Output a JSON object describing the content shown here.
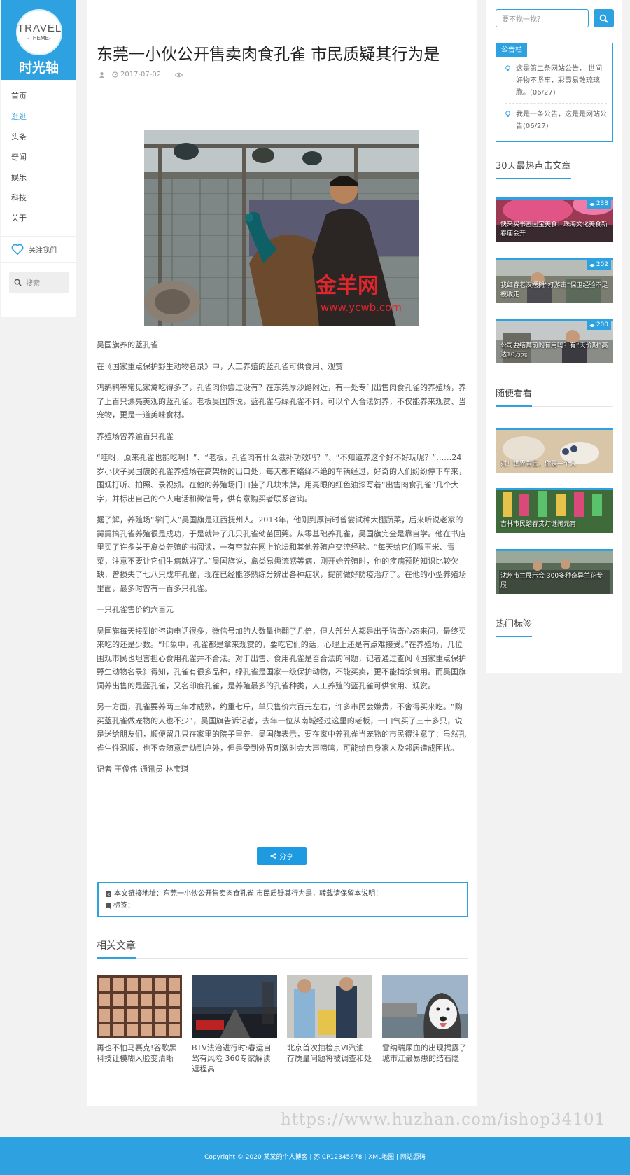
{
  "logo": {
    "word": "TRAVEL",
    "sub": "-THEME-",
    "title": "时光轴"
  },
  "nav": {
    "items": [
      "首页",
      "逛逛",
      "头条",
      "奇闻",
      "娱乐",
      "科技",
      "关于"
    ]
  },
  "follow": {
    "label": "关注我们"
  },
  "side_search": {
    "placeholder": "搜索"
  },
  "article": {
    "title": "东莞一小伙公开售卖肉食孔雀 市民质疑其行为是",
    "date": "2017-07-02",
    "paragraphs": [
      "吴国旗养的蓝孔雀",
      "在《国家重点保护野生动物名录》中，人工养殖的蓝孔雀可供食用、观赏",
      "鸡鹅鸭等常见家禽吃得多了，孔雀肉你尝过没有？在东莞厚沙路附近，有一处专门出售肉食孔雀的养殖场，养了上百只漂亮美观的蓝孔雀。老板吴国旗说，蓝孔雀与绿孔雀不同，可以个人合法饲养，不仅能养来观赏、当宠物，更是一道美味食材。",
      "养殖场曾养逾百只孔雀",
      "“哇呀，原来孔雀也能吃啊！”、“老板，孔雀肉有什么滋补功效吗？”、“不知道养这个好不好玩呢？”……24岁小伙子吴国旗的孔雀养殖场在高架桥的出口处，每天都有络绎不绝的车辆经过，好奇的人们纷纷停下车来，围观打听、拍照、录视频。在他的养殖场门口挂了几块木牌，用亮眼的红色油漆写着“出售肉食孔雀”几个大字，并标出自己的个人电话和微信号，供有意购买者联系咨询。",
      "据了解，养殖场“掌门人”吴国旗是江西抚州人。2013年，他刚到厚街时曾尝试种大棚蔬菜，后来听说老家的舅舅搞孔雀养殖很是成功，于是就带了几只孔雀幼苗回莞。从零基础养孔雀，吴国旗完全是靠自学。他在书店里买了许多关于禽类养殖的书阅读，一有空就在网上论坛和其他养殖户交流经验。“每天给它们喂玉米、青菜，注意不要让它们生病就好了。”吴国旗说，禽类易患流感等病，刚开始养殖时，他的疾病预防知识比较欠缺，曾损失了七八只成年孔雀，现在已经能够熟练分辨出各种症状，提前做好防疫治疗了。在他的小型养殖场里面，最多时曾有一百多只孔雀。",
      "一只孔雀售价约六百元",
      "吴国旗每天接到的咨询电话很多，微信号加的人数量也翻了几倍，但大部分人都是出于猎奇心态来问，最终买来吃的还是少数。“印象中，孔雀都是拿来观赏的，要吃它们的话，心理上还是有点难接受。”在养殖场，几位围观市民也坦言担心食用孔雀并不合法。对于出售、食用孔雀是否合法的问题，记者通过查阅《国家重点保护野生动物名录》得知，孔雀有很多品种，绿孔雀是国家一级保护动物，不能买卖，更不能捕杀食用。而吴国旗饲养出售的是蓝孔雀，又名印度孔雀，是养殖最多的孔雀种类，人工养殖的蓝孔雀可供食用、观赏。",
      "另一方面，孔雀要养两三年才成熟，约重七斤，单只售价六百元左右，许多市民会嫌贵，不舍得买来吃。“购买蓝孔雀做宠物的人也不少”，吴国旗告诉记者，去年一位从南城经过这里的老板，一口气买了三十多只，说是送给朋友们，顺便留几只在家里的院子里养。吴国旗表示，要在家中养孔雀当宠物的市民得注意了：虽然孔雀生性温顺，也不会随意走动到户外，但是受到外界刺激时会大声啼鸣，可能给自身家人及邻居造成困扰。",
      "记者 王俊伟 通讯员 林宝琪"
    ],
    "photo_watermark": "金羊网",
    "photo_url": "www.ycwb.com"
  },
  "share": {
    "label": "分享"
  },
  "copy": {
    "link_text": "本文链接地址：东莞一小伙公开售卖肉食孔雀 市民质疑其行为是，转载请保留本说明！",
    "tags_label": "标签："
  },
  "related": {
    "title": "相关文章",
    "items": [
      {
        "caption": "再也不怕马赛克!谷歌黑科技让模糊人脸变清晰"
      },
      {
        "caption": "BTV法治进行时:春运自驾有风险 360专家解读返程高"
      },
      {
        "caption": "北京首次抽检京VI汽油 存质量问题将被调查和处"
      },
      {
        "caption": "雪纳瑞尿血的出现揭露了城市江最易患的结石隐"
      }
    ]
  },
  "right": {
    "search_placeholder": "要不找一找？",
    "notice": {
      "title": "公告栏",
      "items": [
        "这是第二条网站公告， 世间好物不坚牢，彩霞易散琉璃脆。(06/27)",
        "我是一条公告，这是是网站公告(06/27)"
      ]
    },
    "hot": {
      "title": "30天最热点击文章",
      "items": [
        {
          "caption": "快来买书画回宝美食！珠海文化美食新春庙会开",
          "views": "238"
        },
        {
          "caption": "我红春老汉摆摊“打游击”保卫经验不足被收走",
          "views": "202"
        },
        {
          "caption": "公司要结算前的有用吗？有“天价期”高达10万元",
          "views": "200"
        }
      ]
    },
    "random": {
      "title": "随便看看",
      "items": [
        {
          "caption": "对！世界肯吉，你是一个人"
        },
        {
          "caption": "吉林市民踏春赏灯谜闹元宵"
        },
        {
          "caption": "沈州市兰展示会 300多种奇异兰花参展"
        }
      ]
    },
    "tags_title": "热门标签"
  },
  "watermark": "https://www.huzhan.com/ishop34101",
  "footer": {
    "text": "Copyright © 2020 某某的个人博客 | 苏ICP12345678 | XML地图 | 网站源码"
  },
  "colors": {
    "accent": "#2ea2e0",
    "footer": "#2ea2e0"
  }
}
